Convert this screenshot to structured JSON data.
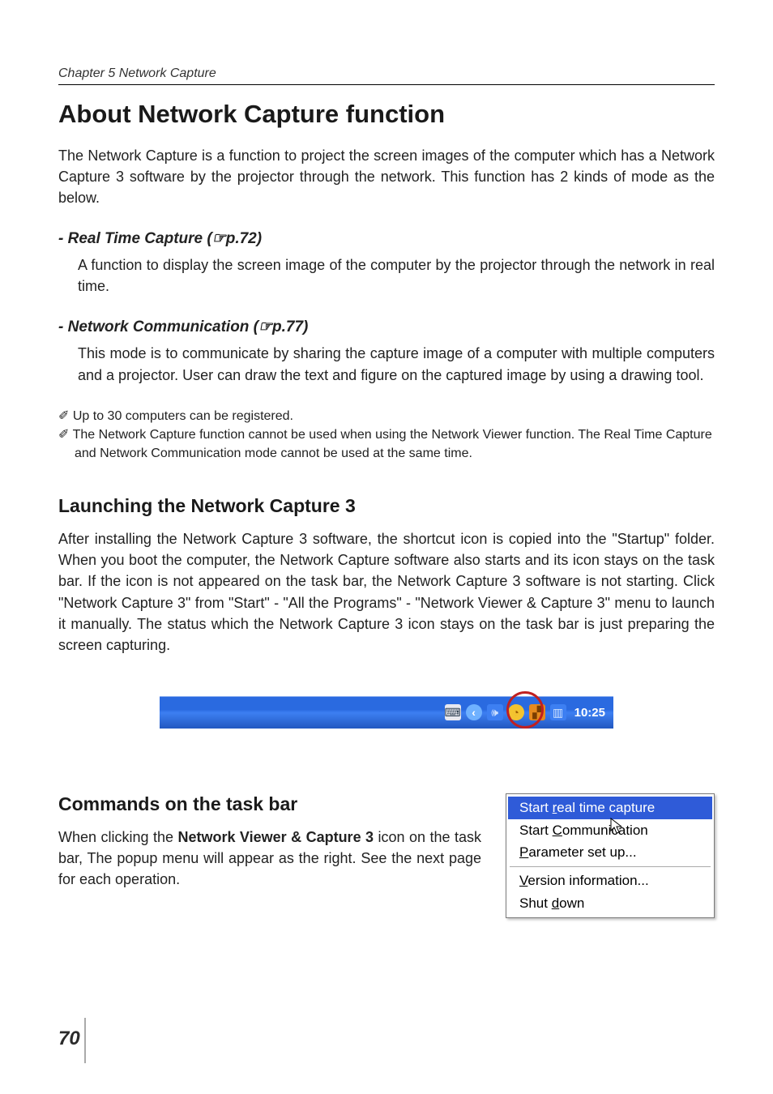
{
  "chapter_header": "Chapter 5 Network Capture",
  "h1": "About Network Capture function",
  "intro": "The Network Capture is a function to project the screen images of the computer which has a Network Capture 3 software by the projector through the network. This function has 2 kinds of mode as the below.",
  "rt": {
    "title": "- Real Time Capture (☞p.72)",
    "body": " A function to display the screen image of the computer by the projector through the network in real time."
  },
  "nc": {
    "title": "- Network Communication (☞p.77)",
    "body": "This mode is to communicate by sharing the capture image of a computer with multiple computers and a projector. User can draw the text and figure on the captured image by using a drawing tool."
  },
  "notes": {
    "n1": "✐ Up to 30 computers can be registered.",
    "n2": "✐ The Network Capture function cannot be used when using the Network Viewer function. The Real Time Capture and Network Communication mode cannot be used at the same time."
  },
  "h2_launch": "Launching the Network Capture 3",
  "launch_para": "After installing the Network Capture 3 software, the shortcut icon is copied into the \"Startup\" folder. When you boot the computer, the Network Capture software also starts and its icon stays on the task bar. If the icon is not appeared on the task bar, the Network Capture 3 software is not starting. Click \"Network Capture 3\" from \"Start\" - \"All the Programs\" - \"Network Viewer & Capture 3\" menu to launch it manually. The status which the Network Capture 3 icon stays on the task bar is just preparing the screen capturing.",
  "taskbar": {
    "clock": "10:25"
  },
  "h2_cmd": "Commands on the task bar",
  "cmd_para_pre": "When clicking the ",
  "cmd_para_bold": "Network Viewer & Capture 3",
  "cmd_para_post": " icon on the task bar, The popup menu will appear as the right. See the next page for each operation.",
  "popup": {
    "i1": {
      "pre": "Start ",
      "u": "r",
      "post": "eal time capture"
    },
    "i2": {
      "pre": "Start ",
      "u": "C",
      "post": "ommunication"
    },
    "i3": {
      "u": "P",
      "post": "arameter set up..."
    },
    "i4": {
      "u": "V",
      "post": "ersion information..."
    },
    "i5": {
      "pre": "Shut ",
      "u": "d",
      "post": "own"
    }
  },
  "page_number": "70"
}
